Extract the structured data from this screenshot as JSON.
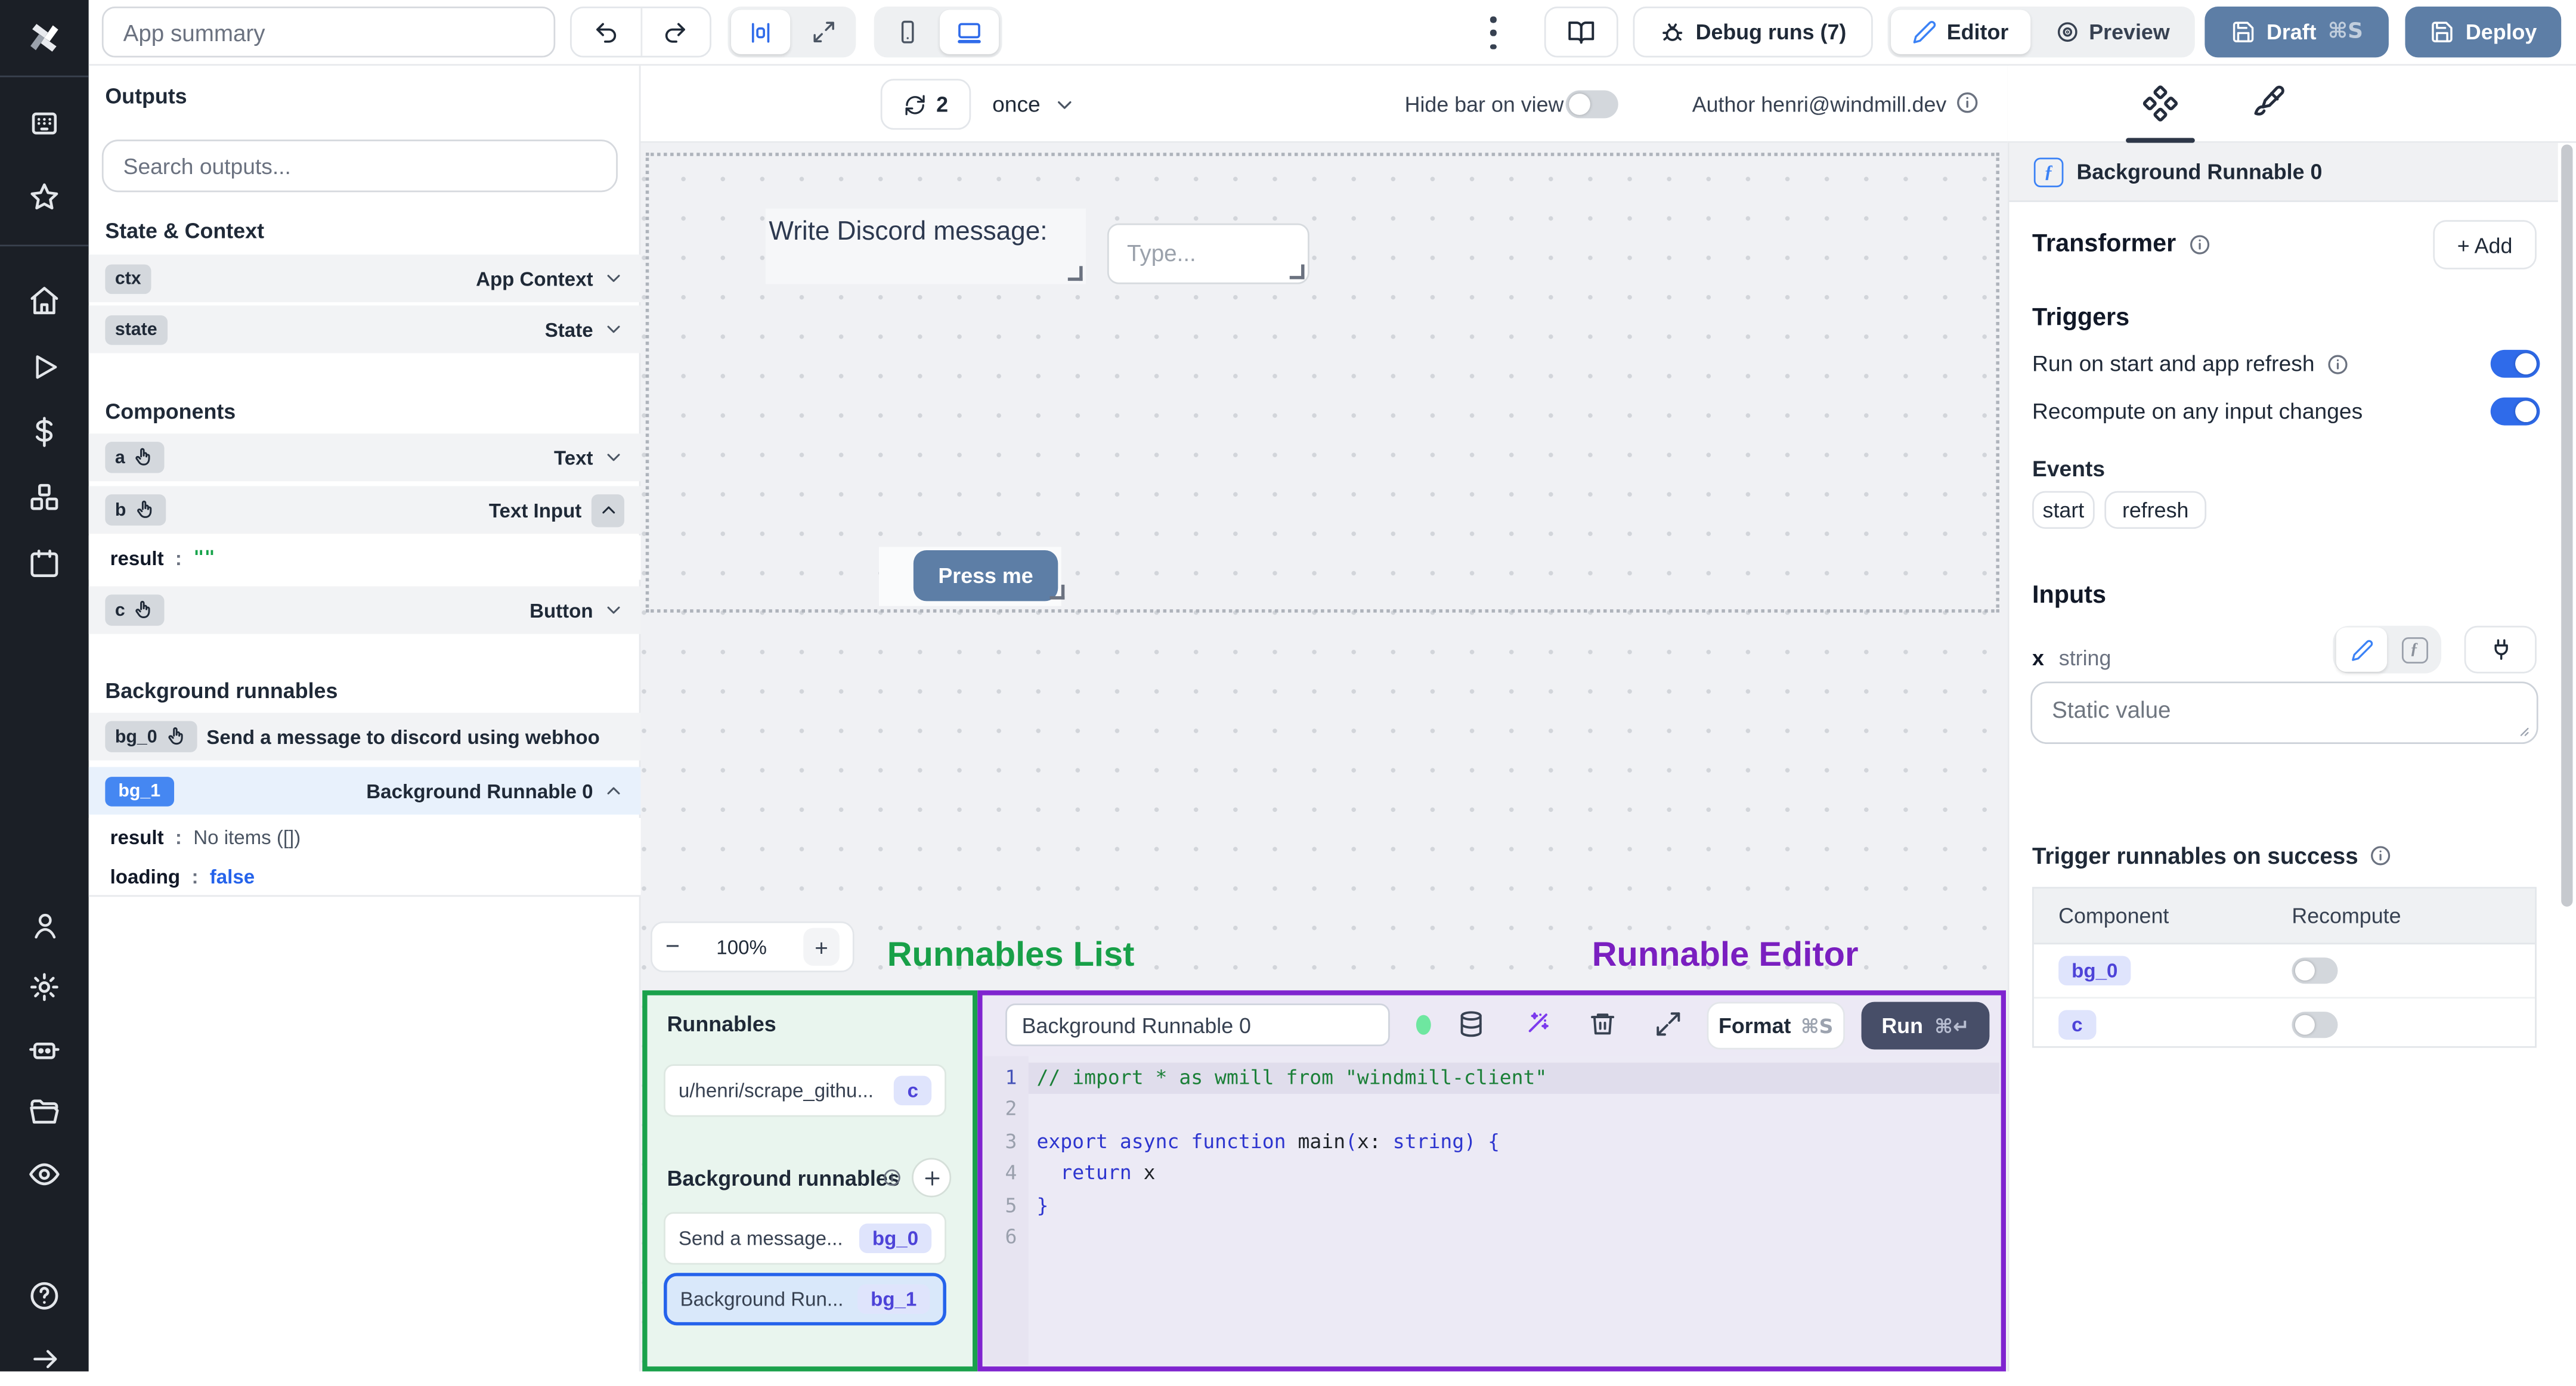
{
  "topbar": {
    "app_summary_placeholder": "App summary",
    "debug_runs_label": "Debug runs (7)",
    "editor_label": "Editor",
    "preview_label": "Preview",
    "draft_label": "Draft",
    "draft_shortcut": "⌘S",
    "deploy_label": "Deploy"
  },
  "sidebar_icons": [
    "windmill-logo",
    "apps-icon",
    "favorites-star-icon",
    "home-icon",
    "runs-play-icon",
    "variables-dollar-icon",
    "resources-cubes-icon",
    "schedules-calendar-icon",
    "user-icon",
    "settings-gear-icon",
    "workers-robot-icon",
    "folders-icon",
    "audit-eye-icon",
    "help-icon",
    "collapse-arrow-icon"
  ],
  "outputs_panel": {
    "title": "Outputs",
    "search_placeholder": "Search outputs...",
    "state_context_title": "State & Context",
    "state_rows": [
      {
        "id": "ctx",
        "type": "App Context"
      },
      {
        "id": "state",
        "type": "State"
      }
    ],
    "components_title": "Components",
    "component_rows": [
      {
        "id": "a",
        "type": "Text"
      },
      {
        "id": "b",
        "type": "Text Input"
      },
      {
        "id": "c",
        "type": "Button"
      }
    ],
    "b_detail": {
      "key": "result",
      "colon": ":",
      "value": "\"\""
    },
    "background_title": "Background runnables",
    "background_rows": [
      {
        "id": "bg_0",
        "label": "Send a message to discord using webhoo"
      },
      {
        "id": "bg_1",
        "label": "Background Runnable 0"
      }
    ],
    "bg1_details": [
      {
        "key": "result",
        "colon": ":",
        "value": "No items ([])"
      },
      {
        "key": "loading",
        "colon": ":",
        "value": "false"
      }
    ]
  },
  "canvas_bar": {
    "refresh_count": "2",
    "run_frequency": "once",
    "hide_bar_label": "Hide bar on view",
    "author_label": "Author henri@windmill.dev"
  },
  "canvas": {
    "text_component": "Write Discord message:",
    "input_placeholder": "Type...",
    "button_label": "Press me",
    "zoom_out": "−",
    "zoom_value": "100%",
    "zoom_in": "+"
  },
  "annotations": {
    "runnables_list": "Runnables List",
    "runnable_editor": "Runnable Editor"
  },
  "runnables_panel": {
    "title": "Runnables",
    "items": [
      {
        "label": "u/henri/scrape_githu...",
        "badge": "c"
      }
    ],
    "background_title": "Background runnables",
    "background_items": [
      {
        "label": "Send a message...",
        "badge": "bg_0"
      },
      {
        "label": "Background Run...",
        "badge": "bg_1"
      }
    ]
  },
  "editor": {
    "name_value": "Background Runnable 0",
    "format_label": "Format",
    "format_shortcut": "⌘S",
    "run_label": "Run",
    "run_shortcut": "⌘↵",
    "code_lines": [
      {
        "num": "1",
        "active": true,
        "tokens": [
          {
            "t": "// import * as wmill from \"windmill-client\"",
            "c": "comment"
          }
        ]
      },
      {
        "num": "2",
        "tokens": []
      },
      {
        "num": "3",
        "tokens": [
          {
            "t": "export",
            "c": "kw"
          },
          {
            "t": " ",
            "c": "plain"
          },
          {
            "t": "async",
            "c": "kw"
          },
          {
            "t": " ",
            "c": "plain"
          },
          {
            "t": "function",
            "c": "kw"
          },
          {
            "t": " ",
            "c": "plain"
          },
          {
            "t": "main",
            "c": "fn"
          },
          {
            "t": "(",
            "c": "kw"
          },
          {
            "t": "x",
            "c": "plain"
          },
          {
            "t": ": ",
            "c": "plain"
          },
          {
            "t": "string",
            "c": "kw"
          },
          {
            "t": ")",
            "c": "kw"
          },
          {
            "t": " {",
            "c": "kw"
          }
        ]
      },
      {
        "num": "4",
        "tokens": [
          {
            "t": "  ",
            "c": "plain"
          },
          {
            "t": "return",
            "c": "kw"
          },
          {
            "t": " x",
            "c": "plain"
          }
        ]
      },
      {
        "num": "5",
        "tokens": [
          {
            "t": "}",
            "c": "kw"
          }
        ]
      },
      {
        "num": "6",
        "tokens": []
      }
    ]
  },
  "right_panel": {
    "breadcrumb": "Background Runnable 0",
    "transformer_title": "Transformer",
    "add_label": "+ Add",
    "triggers_title": "Triggers",
    "trigger_rows": [
      {
        "label": "Run on start and app refresh"
      },
      {
        "label": "Recompute on any input changes"
      }
    ],
    "events_title": "Events",
    "event_chips": [
      "start",
      "refresh"
    ],
    "inputs_title": "Inputs",
    "input_name": "x",
    "input_type": "string",
    "static_placeholder": "Static value",
    "trigger_success_title": "Trigger runnables on success",
    "table": {
      "headers": [
        "Component",
        "Recompute"
      ],
      "rows": [
        {
          "badge": "bg_0"
        },
        {
          "badge": "c"
        }
      ]
    }
  },
  "colors": {
    "accent_blue": "#2f6bea",
    "steel_button": "#5d7ea6",
    "run_button": "#474e68",
    "badge_indigo_text": "#4d43d8",
    "badge_indigo_bg": "#dfe4fc",
    "selected_border": "#2563eb",
    "annotation_green": "#18a048",
    "annotation_purple": "#7a1fc0",
    "sidebar_bg": "#1b1f26"
  }
}
